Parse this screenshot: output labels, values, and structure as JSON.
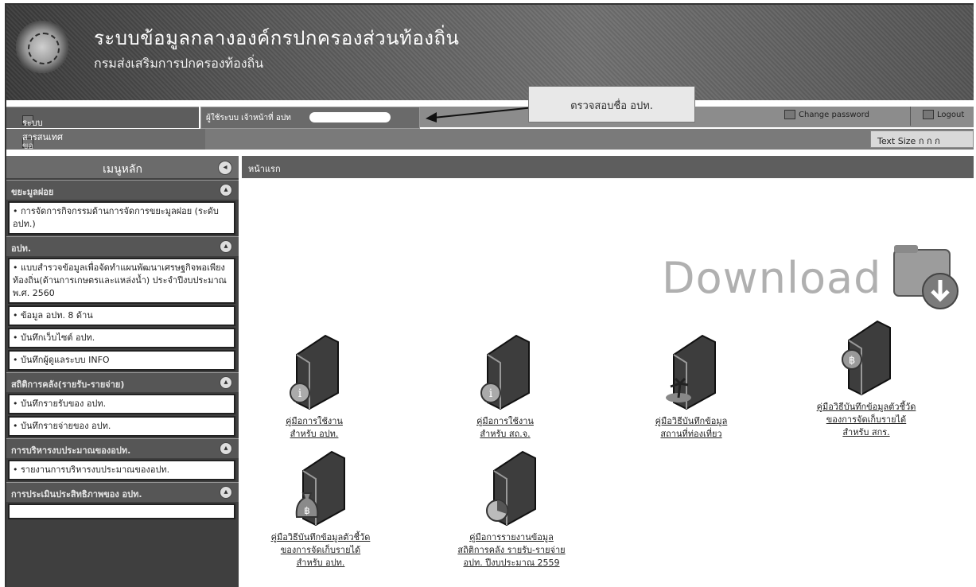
{
  "header": {
    "title": "ระบบข้อมูลกลางองค์กรปกครองส่วนท้องถิ่น",
    "subtitle": "กรมส่งเสริมการปกครองท้องถิ่น"
  },
  "nav": {
    "system_tab": "ระบบสารสนเทศ",
    "user_label": "ผู้ใช้ระบบ เจ้าหน้าที่ อปท",
    "callout": "ตรวจสอบชื่อ อปท.",
    "change_password": "Change password",
    "logout": "Logout",
    "sub_left": "ขอมูลคุณ อปท.",
    "text_size": "Text Size  ก ก ก"
  },
  "sidebar": {
    "title": "เมนูหลัก",
    "sections": [
      {
        "title": "ขยะมูลฝอย",
        "items": [
          "• การจัดการกิจกรรมด้านการจัดการขยะมูลฝอย (ระดับ อปท.)"
        ]
      },
      {
        "title": "อปท.",
        "items": [
          "• แบบสำรวจข้อมูลเพื่อจัดทำแผนพัฒนาเศรษฐกิจพอเพียงท้องถิ่น(ด้านการเกษตรและแหล่งน้ำ) ประจำปีงบประมาณ พ.ศ. 2560",
          "• ข้อมูล อปท. 8 ด้าน",
          "• บันทึกเว็บไซต์ อปท.",
          "• บันทึกผู้ดูแลระบบ INFO"
        ]
      },
      {
        "title": "สถิติการคลัง(รายรับ-รายจ่าย)",
        "items": [
          "• บันทึกรายรับของ อปท.",
          "• บันทึกรายจ่ายของ อปท."
        ]
      },
      {
        "title": "การบริหารงบประมาณของอปท.",
        "items": [
          "• รายงานการบริหารงบประมาณของอปท."
        ]
      },
      {
        "title": "การประเมินประสิทธิภาพของ อปท.",
        "items": []
      }
    ]
  },
  "main": {
    "breadcrumb": "หน้าแรก",
    "download_label": "Download",
    "tiles": [
      {
        "lines": [
          "คู่มือการใช้งาน",
          "สำหรับ อปท."
        ],
        "badge": "info"
      },
      {
        "lines": [
          "คู่มือการใช้งาน",
          "สำหรับ สถ.จ."
        ],
        "badge": "info"
      },
      {
        "lines": [
          "คู่มือวิธีบันทึกข้อมูล",
          "สถานที่ท่องเที่ยว"
        ],
        "badge": "island"
      },
      {
        "lines": [
          "คู่มือวิธีบันทึกข้อมูลตัวชี้วัด",
          "ของการจัดเก็บรายได้",
          "สำหรับ สกร."
        ],
        "badge": "baht"
      },
      {
        "lines": [
          "คู่มือวิธีบันทึกข้อมูลตัวชี้วัด",
          "ของการจัดเก็บรายได้",
          "สำหรับ อปท."
        ],
        "badge": "baht-bag"
      },
      {
        "lines": [
          "คู่มือการรายงานข้อมูล",
          "สถิติการคลัง รายรับ-รายจ่าย",
          "อปท. ปีงบประมาณ 2559"
        ],
        "badge": "chart"
      }
    ]
  }
}
